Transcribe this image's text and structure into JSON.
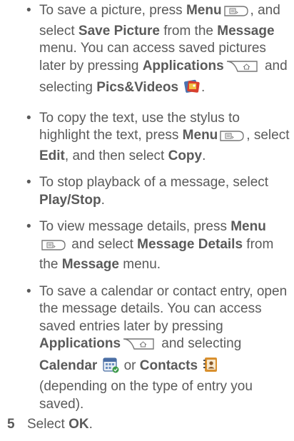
{
  "bullets": [
    {
      "t1": "To save a picture, press ",
      "menu": "Menu",
      "t2": ", and select ",
      "save_picture": "Save Picture",
      "t3": " from the ",
      "message": "Message",
      "t4": " menu. You can access saved pictures later by pressing ",
      "applications": "Applications",
      "t5": " and selecting ",
      "pics": "Pics&Videos",
      "t6": "."
    },
    {
      "t1": "To copy the text, use the stylus to highlight the text, press ",
      "menu": "Menu",
      "t2": ", select ",
      "edit": "Edit",
      "t3": ", and then select ",
      "copy": "Copy",
      "t4": "."
    },
    {
      "t1": "To stop playback of a message, select ",
      "play_stop": "Play/Stop",
      "t2": "."
    },
    {
      "t1": "To view message details, press ",
      "menu": "Menu",
      "t2": " and select ",
      "message_details": "Message Details",
      "t3": " from the ",
      "message": "Message",
      "t4": " menu."
    },
    {
      "t1": "To save a calendar or contact entry, open the message details. You can access saved entries later by pressing ",
      "applications": "Applications",
      "t2": " and selecting ",
      "calendar": "Calendar",
      "t3": " or ",
      "contacts": "Contacts",
      "t4": " (depending on the type of entry you saved)."
    }
  ],
  "step": {
    "number": "5",
    "t1": "Select ",
    "ok": "OK",
    "t2": "."
  },
  "icons": {
    "menu_key": "menu-key-icon",
    "applications_key": "applications-key-icon",
    "pics_videos": "pics-videos-icon",
    "calendar": "calendar-icon",
    "contacts": "contacts-icon"
  },
  "colors": {
    "text": "#5a5a5a",
    "icon_line": "#777777"
  }
}
